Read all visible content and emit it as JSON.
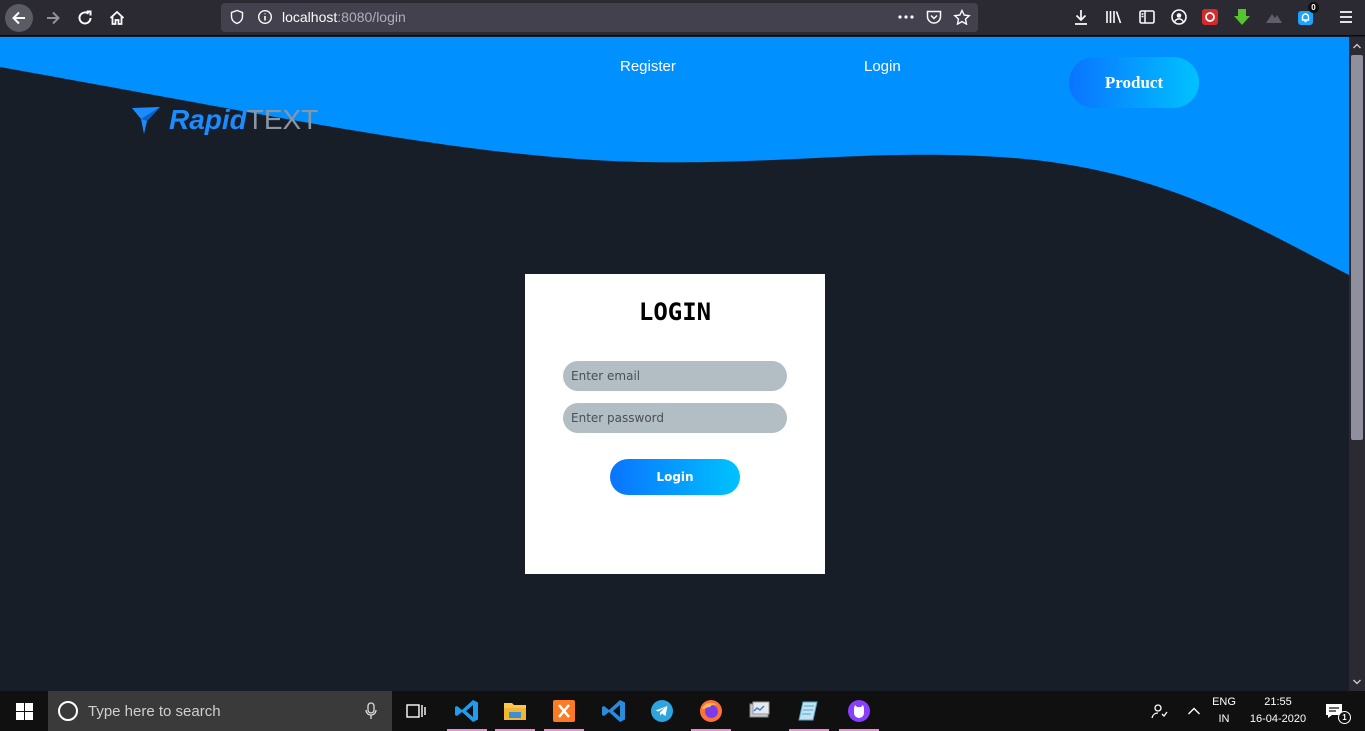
{
  "browser": {
    "url_host": "localhost",
    "url_rest": ":8080/login",
    "notification_count": "0"
  },
  "header": {
    "logo_brand": "Rapid",
    "logo_suffix": "TEXT",
    "nav": {
      "register": "Register",
      "login": "Login"
    },
    "product_button": "Product"
  },
  "login_form": {
    "title": "LOGIN",
    "email_placeholder": "Enter email",
    "password_placeholder": "Enter password",
    "submit_label": "Login"
  },
  "taskbar": {
    "search_placeholder": "Type here to search",
    "language": "ENG",
    "region": "IN",
    "time": "21:55",
    "date": "16-04-2020",
    "notification_badge": "1"
  },
  "colors": {
    "page_background": "#171e28",
    "accent_blue": "#0090ff",
    "button_gradient_start": "#0a74ff",
    "button_gradient_end": "#00c2ff",
    "input_background": "#b2bec3"
  }
}
